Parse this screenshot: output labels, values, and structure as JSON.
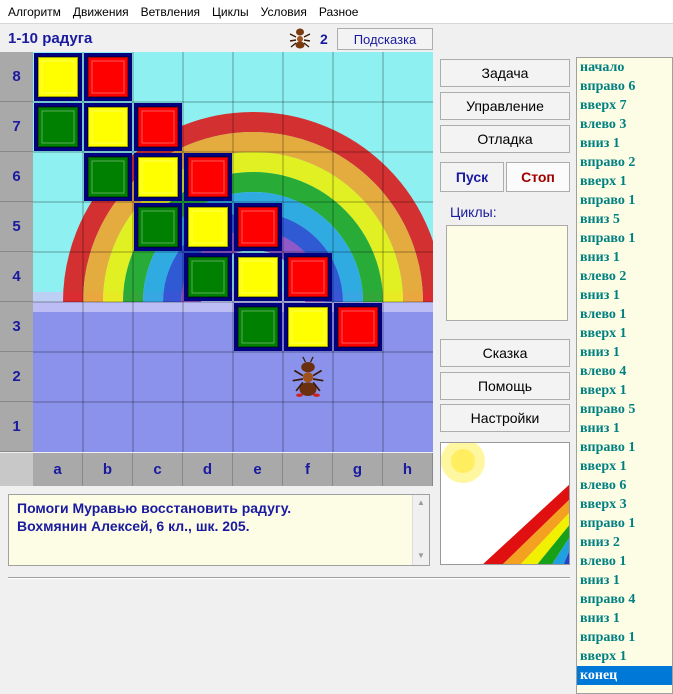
{
  "menu": [
    "Алгоритм",
    "Движения",
    "Ветвления",
    "Циклы",
    "Условия",
    "Разное"
  ],
  "header": {
    "title": "1-10 радуга",
    "ant_count": "2",
    "hint_label": "Подсказка"
  },
  "field": {
    "ranks": [
      "8",
      "7",
      "6",
      "5",
      "4",
      "3",
      "2",
      "1"
    ],
    "files": [
      "a",
      "b",
      "c",
      "d",
      "e",
      "f",
      "g",
      "h"
    ],
    "cells": [
      {
        "col": 0,
        "row": 0,
        "color": "yellow"
      },
      {
        "col": 1,
        "row": 0,
        "color": "red"
      },
      {
        "col": 0,
        "row": 1,
        "color": "green"
      },
      {
        "col": 1,
        "row": 1,
        "color": "yellow"
      },
      {
        "col": 2,
        "row": 1,
        "color": "red"
      },
      {
        "col": 1,
        "row": 2,
        "color": "green"
      },
      {
        "col": 2,
        "row": 2,
        "color": "yellow"
      },
      {
        "col": 3,
        "row": 2,
        "color": "red"
      },
      {
        "col": 2,
        "row": 3,
        "color": "green"
      },
      {
        "col": 3,
        "row": 3,
        "color": "yellow"
      },
      {
        "col": 4,
        "row": 3,
        "color": "red"
      },
      {
        "col": 3,
        "row": 4,
        "color": "green"
      },
      {
        "col": 4,
        "row": 4,
        "color": "yellow"
      },
      {
        "col": 5,
        "row": 4,
        "color": "red"
      },
      {
        "col": 4,
        "row": 5,
        "color": "green"
      },
      {
        "col": 5,
        "row": 5,
        "color": "yellow"
      },
      {
        "col": 6,
        "row": 5,
        "color": "red"
      }
    ],
    "ant": {
      "col": 5,
      "row": 6
    },
    "colors": {
      "yellow": "#ffff00",
      "red": "#ff0000",
      "green": "#008000",
      "frame": "#000080",
      "sky": "#8ef0f0",
      "water": "#8a92ec"
    }
  },
  "buttons": {
    "task": "Задача",
    "control": "Управление",
    "debug": "Отладка",
    "run": "Пуск",
    "stop": "Стоп",
    "tale": "Сказка",
    "help": "Помощь",
    "settings": "Настройки"
  },
  "cycles_label": "Циклы:",
  "message": [
    "Помоги Муравью восстановить радугу.",
    "Вохмянин Алексей, 6 кл., шк. 205."
  ],
  "program": [
    "начало",
    "вправо 6",
    "вверх 7",
    "влево 3",
    "вниз 1",
    "вправо 2",
    "вверх 1",
    "вправо 1",
    "вниз 5",
    "вправо 1",
    "вниз 1",
    "влево 2",
    "вниз 1",
    "влево 1",
    "вверх 1",
    "вниз 1",
    "влево 4",
    "вверх 1",
    "вправо 5",
    "вниз 1",
    "вправо 1",
    "вверх 1",
    "влево 6",
    "вверх 3",
    "вправо 1",
    "вниз 2",
    "влево 1",
    "вниз 1",
    "вправо 4",
    "вниз 1",
    "вправо 1",
    "вверх 1",
    "конец"
  ],
  "program_selected": 32
}
